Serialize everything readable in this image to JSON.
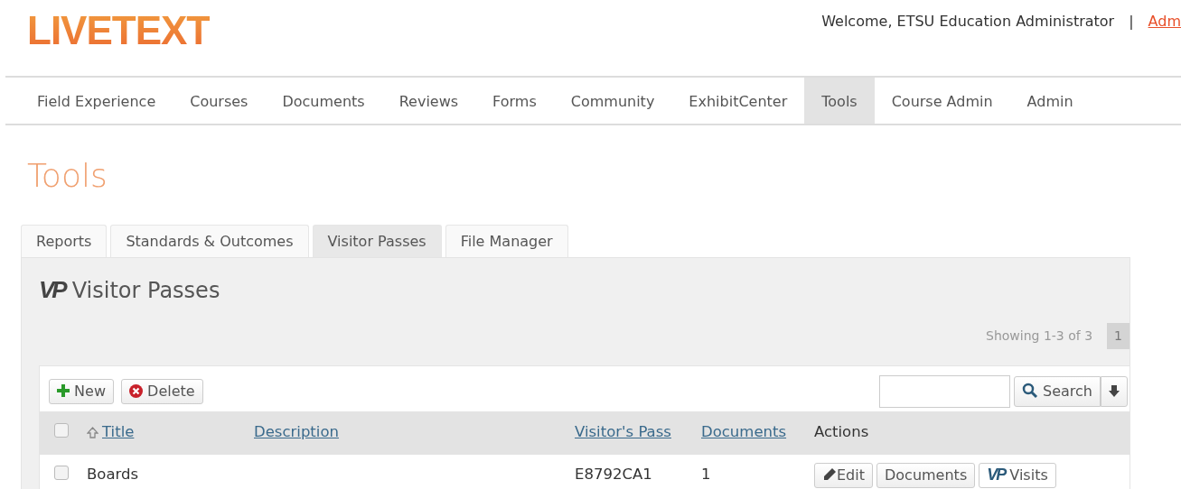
{
  "logo": "LIVETEXT",
  "header": {
    "welcome": "Welcome, ETSU Education Administrator",
    "separator": "|",
    "link": "Adm"
  },
  "nav": [
    {
      "label": "Field Experience",
      "selected": false
    },
    {
      "label": "Courses",
      "selected": false
    },
    {
      "label": "Documents",
      "selected": false
    },
    {
      "label": "Reviews",
      "selected": false
    },
    {
      "label": "Forms",
      "selected": false
    },
    {
      "label": "Community",
      "selected": false
    },
    {
      "label": "ExhibitCenter",
      "selected": false
    },
    {
      "label": "Tools",
      "selected": true
    },
    {
      "label": "Course Admin",
      "selected": false
    },
    {
      "label": "Admin",
      "selected": false
    }
  ],
  "page_title": "Tools",
  "tabs": [
    {
      "label": "Reports",
      "selected": false
    },
    {
      "label": "Standards & Outcomes",
      "selected": false
    },
    {
      "label": "Visitor Passes",
      "selected": true
    },
    {
      "label": "File Manager",
      "selected": false
    }
  ],
  "panel": {
    "icon_text": "VP",
    "title": "Visitor Passes",
    "showing": "Showing 1-3 of 3",
    "pages": [
      {
        "label": "1",
        "selected": true
      }
    ]
  },
  "toolbar": {
    "new": "New",
    "delete": "Delete",
    "search": "Search"
  },
  "table": {
    "select_all_checked": false,
    "columns": [
      {
        "label": "Title",
        "sortable": true,
        "sorted": true
      },
      {
        "label": "Description",
        "sortable": true,
        "sorted": false
      },
      {
        "label": "Visitor's Pass",
        "sortable": true,
        "sorted": false
      },
      {
        "label": "Documents",
        "sortable": true,
        "sorted": false
      },
      {
        "label": "Actions",
        "sortable": false,
        "sorted": false
      }
    ],
    "rows": [
      {
        "checked": false,
        "title": "Boards",
        "description": "",
        "pass": "E8792CA1",
        "documents": "1",
        "actions": [
          {
            "kind": "edit",
            "label": "Edit"
          },
          {
            "kind": "plain",
            "label": "Documents"
          },
          {
            "kind": "vp",
            "icon_text": "VP",
            "label": "Visits"
          }
        ]
      }
    ]
  }
}
